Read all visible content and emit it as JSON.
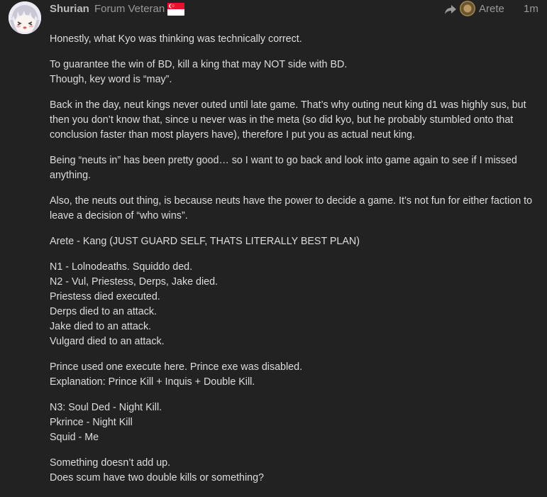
{
  "user": {
    "name": "Shurian",
    "title": "Forum Veteran"
  },
  "reply_to": {
    "name": "Arete"
  },
  "post_time": "1m",
  "colors": {
    "background": "#222222",
    "text": "#dddddd",
    "muted": "#999999",
    "flag_red": "#e8112d"
  },
  "paragraphs": [
    [
      "Honestly, what Kyo was thinking was technically correct."
    ],
    [
      "To guarantee the win of BD, kill a king that may NOT side with BD.",
      "Though, key word is “may”."
    ],
    [
      "Back in the day, neut kings never outed until late game. That’s why outing neut king d1 was highly sus, but then you don’t know that, since u never was in the meta (so did kyo, but he probably stumbled onto that conclusion faster than most players have), therefore I put you as actual neut king."
    ],
    [
      "Being “neuts in” has been pretty good… so I want to go back and look into game again to see if I missed anything."
    ],
    [
      "Also, the neuts out thing, is because neuts have the power to decide a game. It’s not fun for either faction to leave a decision of “who wins”."
    ],
    [
      "Arete - Kang (JUST GUARD SELF, THATS LITERALLY BEST PLAN)"
    ],
    [
      "N1 - Lolnodeaths. Squiddo ded.",
      "N2 - Vul, Priestess, Derps, Jake died.",
      "Priestess died executed.",
      "Derps died to an attack.",
      "Jake died to an attack.",
      "Vulgard died to an attack."
    ],
    [
      "Prince used one execute here. Prince exe was disabled.",
      "Explanation: Prince Kill + Inquis + Double Kill."
    ],
    [
      "N3: Soul Ded - Night Kill.",
      "Pkrince - Night Kill",
      "Squid - Me"
    ],
    [
      "Something doesn’t add up.",
      "Does scum have two double kills or something?"
    ]
  ]
}
